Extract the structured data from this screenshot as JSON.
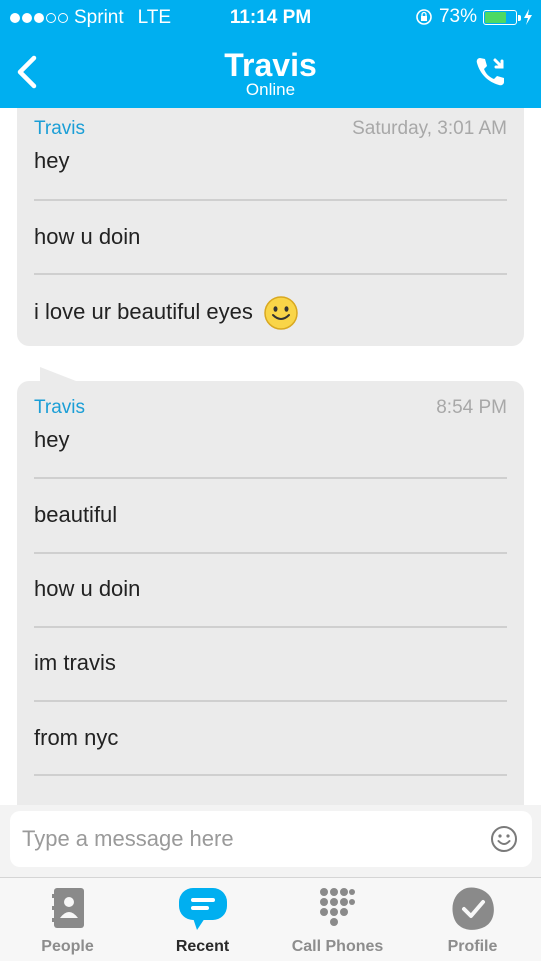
{
  "status_bar": {
    "carrier": "Sprint",
    "network": "LTE",
    "time": "11:14 PM",
    "battery_percent": "73%",
    "battery_level": 0.73
  },
  "header": {
    "title": "Travis",
    "subtitle": "Online",
    "accent_color": "#00aff0"
  },
  "messages": [
    {
      "sender": "Travis",
      "time": "Saturday, 3:01 AM",
      "lines": [
        "hey",
        "how u doin",
        "i love ur beautiful eyes"
      ]
    },
    {
      "sender": "Travis",
      "time": "8:54 PM",
      "lines": [
        "hey",
        "beautiful",
        "how u doin",
        "im travis",
        "from nyc"
      ]
    }
  ],
  "input": {
    "placeholder": "Type a message here"
  },
  "tabs": [
    {
      "label": "People",
      "icon": "contacts-icon"
    },
    {
      "label": "Recent",
      "icon": "chat-bubble-icon",
      "active": true
    },
    {
      "label": "Call Phones",
      "icon": "dialpad-icon"
    },
    {
      "label": "Profile",
      "icon": "profile-icon"
    }
  ]
}
